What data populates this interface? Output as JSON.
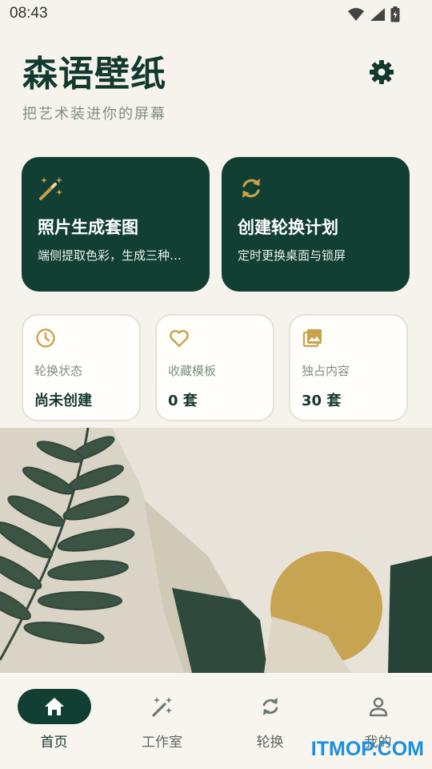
{
  "status_bar": {
    "time": "08:43",
    "icons": [
      "wifi-icon",
      "signal-icon",
      "battery-charging-icon"
    ]
  },
  "header": {
    "title": "森语壁纸",
    "subtitle": "把艺术装进你的屏幕",
    "settings_icon": "gear-icon"
  },
  "feature_cards": [
    {
      "title": "照片生成套图",
      "description": "端侧提取色彩，生成三种…",
      "icon": "magic-wand-icon"
    },
    {
      "title": "创建轮换计划",
      "description": "定时更换桌面与锁屏",
      "icon": "rotate-icon"
    }
  ],
  "stats": [
    {
      "label": "轮换状态",
      "value": "尚未创建",
      "icon": "clock-icon"
    },
    {
      "label": "收藏模板",
      "value": "0 套",
      "icon": "heart-icon"
    },
    {
      "label": "独占内容",
      "value": "30 套",
      "icon": "image-icon"
    }
  ],
  "bottom_nav": [
    {
      "label": "首页",
      "icon": "home-icon",
      "active": true
    },
    {
      "label": "工作室",
      "icon": "magic-wand-icon",
      "active": false
    },
    {
      "label": "轮换",
      "icon": "rotate-icon",
      "active": false
    },
    {
      "label": "我的",
      "icon": "person-icon",
      "active": false
    }
  ],
  "watermark": "ITMOP.COM",
  "colors": {
    "background": "#f6f3ec",
    "primary": "#123f33",
    "accent_gold": "#c9a24a",
    "muted_text": "#7e9180"
  }
}
